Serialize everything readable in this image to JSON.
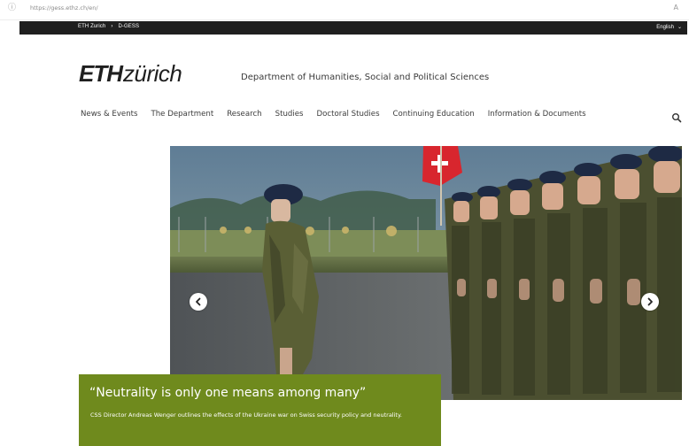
{
  "browser": {
    "url": "https://gess.ethz.ch/en/"
  },
  "topbar": {
    "crumbs": [
      "ETH Zurich",
      "D-GESS"
    ],
    "language": "English"
  },
  "header": {
    "logo_bold": "ETH",
    "logo_rest": "zürich",
    "department": "Department of Humanities, Social and Political Sciences"
  },
  "nav": {
    "items": [
      "News & Events",
      "The Department",
      "Research",
      "Studies",
      "Doctoral Studies",
      "Continuing Education",
      "Information & Documents"
    ],
    "search_icon": "search-icon"
  },
  "hero": {
    "prev_icon": "chevron-left-icon",
    "next_icon": "chevron-right-icon"
  },
  "caption": {
    "title": "“Neutrality is only one means among many”",
    "text": "CSS Director Andreas Wenger outlines the effects of the Ukraine war on Swiss security policy and neutrality."
  },
  "colors": {
    "topbar": "#1f1f1f",
    "caption_bg": "#6f8a1d",
    "text": "#3d3d3d"
  }
}
